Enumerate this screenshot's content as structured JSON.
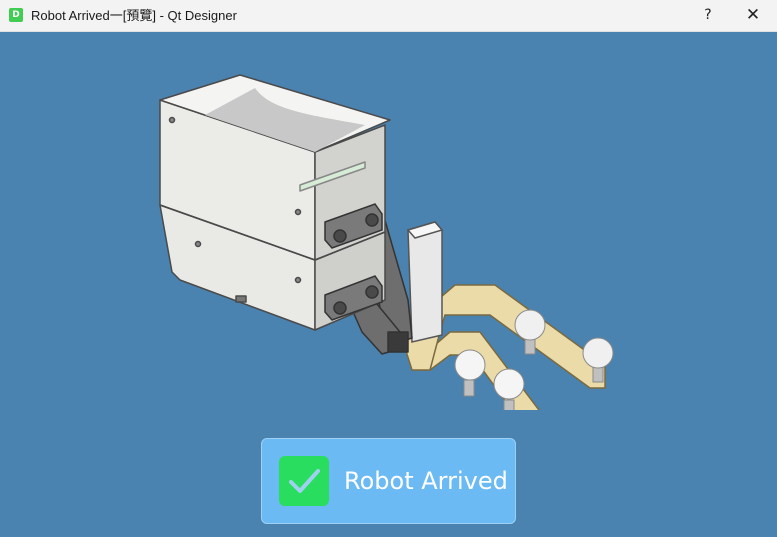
{
  "window": {
    "title": "Robot Arrived一[預覽] - Qt Designer",
    "app_icon_letter": "D",
    "help_label": "?",
    "close_label": "✕"
  },
  "status": {
    "label": "Robot Arrived",
    "check_icon": "check-icon",
    "badge_color": "#6cbaf4",
    "check_color": "#29de5e"
  },
  "colors": {
    "background": "#4a82b0"
  }
}
